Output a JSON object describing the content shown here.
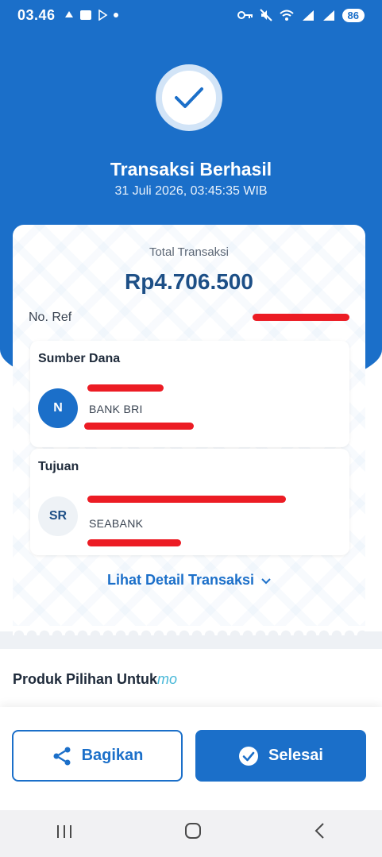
{
  "statusbar": {
    "time": "03.46",
    "battery": "86"
  },
  "header": {
    "title": "Transaksi Berhasil",
    "datetime": "31 Juli 2026, 03:45:35 WIB"
  },
  "receipt": {
    "total_label": "Total Transaksi",
    "total_amount": "Rp4.706.500",
    "ref_label": "No. Ref",
    "source": {
      "title": "Sumber Dana",
      "initial": "N",
      "bank": "BANK BRI"
    },
    "destination": {
      "title": "Tujuan",
      "initial": "SR",
      "bank": "SEABANK"
    },
    "detail_link": "Lihat Detail Transaksi"
  },
  "produk": {
    "title": "Produk Pilihan Untuk",
    "brand": "mo"
  },
  "actions": {
    "share_label": "Bagikan",
    "done_label": "Selesai"
  },
  "colors": {
    "primary": "#1b6fc9",
    "redaction": "#ec1c24"
  },
  "icons": [
    "check-icon",
    "share-icon",
    "check-circle-icon",
    "chevron-down-icon",
    "recents-icon",
    "home-icon",
    "back-icon"
  ]
}
